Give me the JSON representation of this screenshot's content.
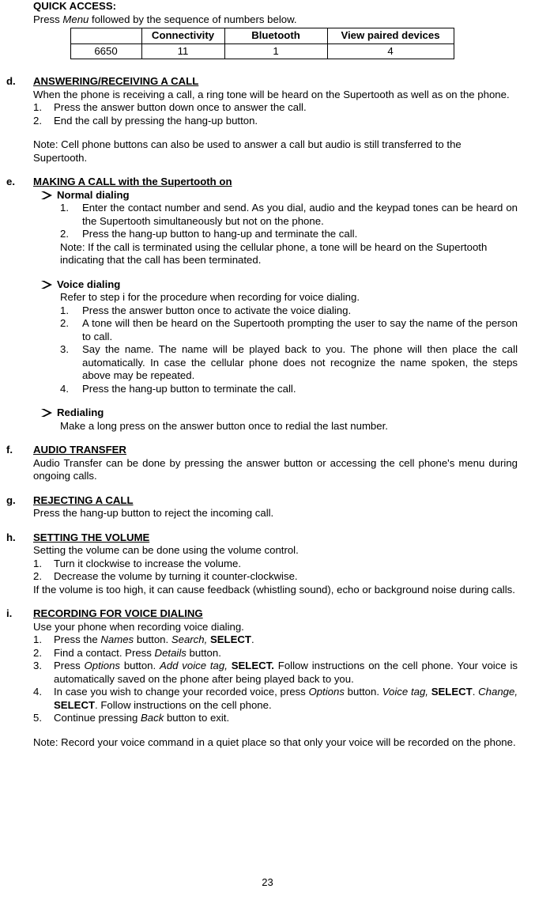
{
  "quick_access": {
    "title": "QUICK ACCESS:",
    "instruction_pre": "Press ",
    "instruction_menu": "Menu",
    "instruction_post": " followed by the sequence of numbers below.",
    "headers": [
      "",
      "Connectivity",
      "Bluetooth",
      "View paired devices"
    ],
    "row": [
      "6650",
      "11",
      "1",
      "4"
    ]
  },
  "d": {
    "letter": "d.",
    "heading": "ANSWERING/RECEIVING A CALL",
    "p1": "When the phone is receiving a call, a ring tone will be heard on the Supertooth as well as on the phone.",
    "s1n": "1.",
    "s1": "Press the answer button down once to answer the call.",
    "s2n": "2.",
    "s2": "End the call by pressing the hang-up button.",
    "note": "Note: Cell phone buttons can also be used to answer a call but audio is still transferred to the Supertooth."
  },
  "e": {
    "letter": "e.",
    "heading": "MAKING A CALL with the Supertooth on",
    "normal": {
      "title": "Normal dialing",
      "s1n": "1.",
      "s1": "Enter the contact number and send. As you dial, audio and the keypad tones can be heard on the Supertooth simultaneously but not on the phone.",
      "s2n": "2.",
      "s2": "Press the hang-up button to hang-up and terminate the call.",
      "note": "Note: If the call is terminated using the cellular phone, a tone will be heard on the Supertooth indicating that the call has been terminated."
    },
    "voice": {
      "title": "Voice dialing",
      "intro": "Refer to step i for the procedure when recording for voice dialing.",
      "s1n": "1.",
      "s1": "Press the answer button once to activate the voice dialing.",
      "s2n": "2.",
      "s2": "A tone will then be heard on the Supertooth prompting the user to say the name of the person to call.",
      "s3n": "3.",
      "s3": "Say the name. The name will be played back to you. The phone will then place the call automatically. In case the cellular phone does not recognize the name spoken, the steps above may be repeated.",
      "s4n": "4.",
      "s4": "Press the hang-up button to terminate the call."
    },
    "redial": {
      "title": "Redialing",
      "body": "Make a long press on the answer button once to redial the last number."
    }
  },
  "f": {
    "letter": "f.",
    "heading": "AUDIO TRANSFER",
    "body": "Audio Transfer can be done by pressing the answer button or accessing the cell phone's menu during ongoing calls."
  },
  "g": {
    "letter": "g.",
    "heading": "REJECTING A CALL",
    "body": "Press the hang-up button to reject the incoming call."
  },
  "h": {
    "letter": "h.",
    "heading": "SETTING THE VOLUME",
    "p1": "Setting the volume can be done using the volume control.",
    "s1n": "1.",
    "s1": "Turn it clockwise to increase the volume.",
    "s2n": "2.",
    "s2": "Decrease the volume by turning it counter-clockwise.",
    "p2": "If the volume is too high, it can cause feedback (whistling sound), echo or background noise during calls."
  },
  "i": {
    "letter": "i.",
    "heading": "RECORDING FOR VOICE DIALING",
    "p1": "Use your phone when recording voice dialing.",
    "s1n": "1.",
    "s1a": "Press the ",
    "s1b": "Names",
    "s1c": " button. ",
    "s1d": "Search,",
    "s1e": " ",
    "s1f": "SELECT",
    "s1g": ".",
    "s2n": "2.",
    "s2a": "Find a contact. Press ",
    "s2b": "Details",
    "s2c": " button.",
    "s3n": "3.",
    "s3a": "Press ",
    "s3b": "Options",
    "s3c": " button. ",
    "s3d": "Add voice tag,",
    "s3e": " ",
    "s3f": "SELECT.",
    "s3g": " Follow instructions on the cell phone. Your voice is automatically saved on the phone after being played back to you.",
    "s4n": "4.",
    "s4a": "In case you wish to change your recorded voice, press ",
    "s4b": "Options",
    "s4c": " button. ",
    "s4d": "Voice tag,",
    "s4e": " ",
    "s4f": "SELECT",
    "s4g": ". ",
    "s4h": "Change,",
    "s4i": " ",
    "s4j": "SELECT",
    "s4k": ". Follow instructions on the cell phone.",
    "s5n": "5.",
    "s5a": "Continue pressing ",
    "s5b": "Back",
    "s5c": " button to exit.",
    "note": "Note: Record your voice command in a quiet place so that only your voice will be recorded on the phone."
  },
  "page_number": "23"
}
